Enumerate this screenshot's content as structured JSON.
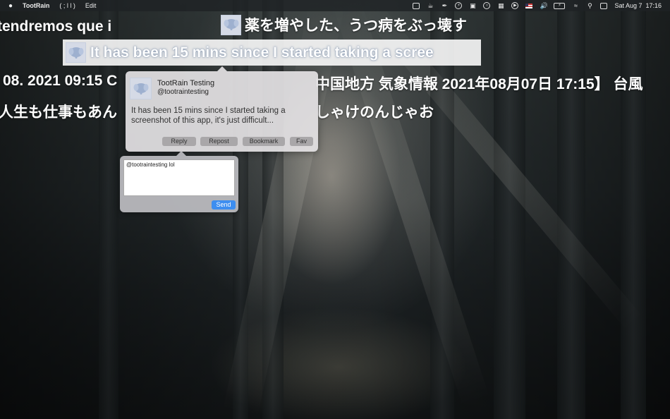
{
  "menubar": {
    "apple_icon": "apple-icon",
    "app_name": "TootRain",
    "menu_item_1": "( ; l l )",
    "menu_item_2": "Edit",
    "status_icons": [
      "screen-icon",
      "coffee-icon",
      "pen-icon",
      "bolt-icon",
      "database-icon",
      "circle-icon",
      "network-icon",
      "play-icon",
      "flag-icon",
      "volume-icon",
      "battery-icon",
      "wifi-icon",
      "search-icon",
      "control-center-icon"
    ],
    "datetime": "Sat Aug 7  17:16"
  },
  "floating_texts": {
    "line1_left": "tendremos que i",
    "line1_right": "薬を増やした、うつ病をぶっ壊す",
    "highlighted": "It has been 15 mins since I started taking a scree",
    "line3_left": "08. 2021 09:15 C",
    "line3_right": "中国地方 気象情報 2021年08月07日 17:15】 台風",
    "line4_left": "人生も仕事もあん",
    "line4_right": "しゃけのんじゃお"
  },
  "toot": {
    "display_name": "TootRain Testing",
    "handle": "@tootraintesting",
    "body": "It has been 15 mins since I started taking a screenshot of this app, it's just difficult...",
    "reply_label": "Reply",
    "repost_label": "Repost",
    "bookmark_label": "Bookmark",
    "fav_label": "Fav"
  },
  "reply": {
    "value": "@tootraintesting lol",
    "send_label": "Send"
  },
  "colors": {
    "accent": "#3d8ef0",
    "avatar_bg": "#d5dae6"
  }
}
